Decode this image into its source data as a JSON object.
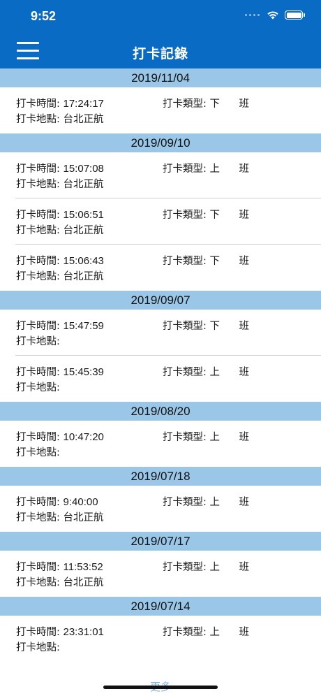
{
  "status_bar": {
    "time": "9:52"
  },
  "header": {
    "title": "打卡記錄"
  },
  "labels": {
    "time": "打卡時間:",
    "place": "打卡地點:",
    "type": "打卡類型:"
  },
  "groups": [
    {
      "date": "2019/11/04",
      "records": [
        {
          "time": "17:24:17",
          "type_1": "下",
          "type_2": "班",
          "place": "台北正航"
        }
      ]
    },
    {
      "date": "2019/09/10",
      "records": [
        {
          "time": "15:07:08",
          "type_1": "上",
          "type_2": "班",
          "place": "台北正航"
        },
        {
          "time": "15:06:51",
          "type_1": "下",
          "type_2": "班",
          "place": "台北正航"
        },
        {
          "time": "15:06:43",
          "type_1": "下",
          "type_2": "班",
          "place": "台北正航"
        }
      ]
    },
    {
      "date": "2019/09/07",
      "records": [
        {
          "time": "15:47:59",
          "type_1": "下",
          "type_2": "班",
          "place": ""
        },
        {
          "time": "15:45:39",
          "type_1": "上",
          "type_2": "班",
          "place": ""
        }
      ]
    },
    {
      "date": "2019/08/20",
      "records": [
        {
          "time": "10:47:20",
          "type_1": "上",
          "type_2": "班",
          "place": ""
        }
      ]
    },
    {
      "date": "2019/07/18",
      "records": [
        {
          "time": "9:40:00",
          "type_1": "上",
          "type_2": "班",
          "place": "台北正航"
        }
      ]
    },
    {
      "date": "2019/07/17",
      "records": [
        {
          "time": "11:53:52",
          "type_1": "上",
          "type_2": "班",
          "place": "台北正航"
        }
      ]
    },
    {
      "date": "2019/07/14",
      "records": [
        {
          "time": "23:31:01",
          "type_1": "上",
          "type_2": "班",
          "place": ""
        }
      ]
    }
  ],
  "footer": {
    "more": "更多"
  },
  "colors": {
    "header_bg": "#0a6bc5",
    "date_bg": "#9ac7e7",
    "more_link": "#7fb3de"
  }
}
